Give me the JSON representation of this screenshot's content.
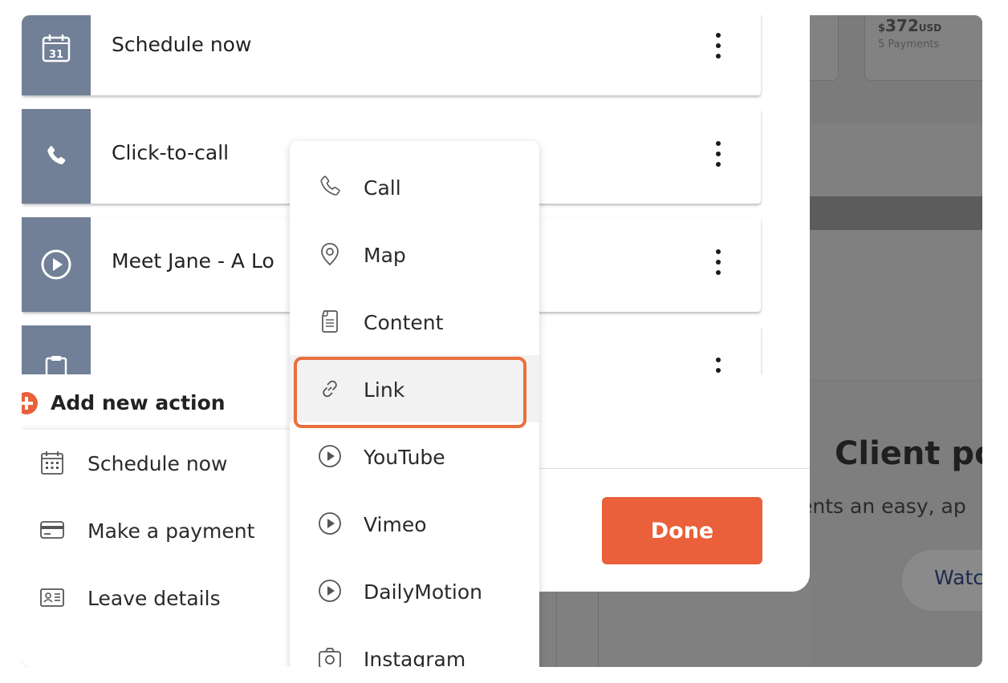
{
  "background": {
    "payment_card": {
      "amount_symbol": "$",
      "amount": "372",
      "currency": "USD",
      "payments": "5 Payments"
    },
    "title": "Client po",
    "subtitle": "ents an easy, ap",
    "watch_button": "Watc"
  },
  "dialog": {
    "actions": [
      {
        "label": "Schedule now",
        "icon": "calendar-31-icon"
      },
      {
        "label": "Click-to-call",
        "icon": "phone-icon"
      },
      {
        "label": "Meet Jane - A Lo",
        "icon": "play-circle-icon"
      },
      {
        "label": "",
        "icon": "clipboard-icon"
      }
    ],
    "add_new_action": "Add new action",
    "done_label": "Done"
  },
  "add_action_menu": {
    "items": [
      {
        "label": "Schedule now",
        "icon": "calendar-icon"
      },
      {
        "label": "Make a payment",
        "icon": "credit-card-icon"
      },
      {
        "label": "Leave details",
        "icon": "id-card-icon"
      }
    ]
  },
  "type_dropdown": {
    "items": [
      {
        "label": "Call",
        "icon": "phone-icon"
      },
      {
        "label": "Map",
        "icon": "map-pin-icon"
      },
      {
        "label": "Content",
        "icon": "document-icon"
      },
      {
        "label": "Link",
        "icon": "link-icon",
        "highlighted": true
      },
      {
        "label": "YouTube",
        "icon": "play-circle-icon"
      },
      {
        "label": "Vimeo",
        "icon": "play-circle-icon"
      },
      {
        "label": "DailyMotion",
        "icon": "play-circle-icon"
      },
      {
        "label": "Instagram",
        "icon": "camera-icon"
      }
    ]
  },
  "colors": {
    "accent": "#e9603a",
    "row_icon_bg": "#718096",
    "highlight": "#e8703d"
  }
}
